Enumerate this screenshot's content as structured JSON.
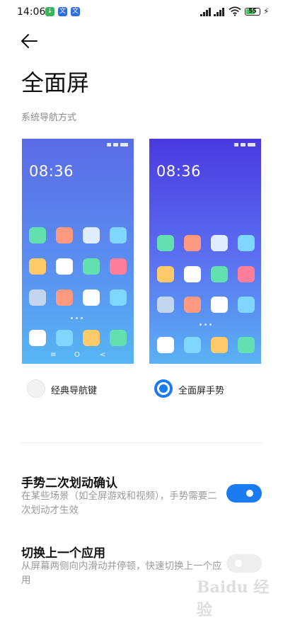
{
  "status_bar": {
    "time": "14:06",
    "battery": "55",
    "notif_icons": [
      "↓",
      "文",
      "文"
    ]
  },
  "page": {
    "title": "全面屏",
    "section_label": "系统导航方式"
  },
  "previews": {
    "classic": {
      "clock": "08:36",
      "nav_keys": [
        "≡",
        "O",
        "<"
      ]
    },
    "gesture": {
      "clock": "08:36"
    }
  },
  "options": [
    {
      "label": "经典导航键",
      "selected": false
    },
    {
      "label": "全面屏手势",
      "selected": true
    }
  ],
  "settings": [
    {
      "title": "手势二次划动确认",
      "desc": "在某些场景（如全屏游戏和视频），手势需要二次划动才生效",
      "enabled": true
    },
    {
      "title": "切换上一个应用",
      "desc": "从屏幕两侧向内滑动并停顿，快速切换上一个应用",
      "enabled": false
    }
  ],
  "watermark": "Baidu 经验",
  "colors": {
    "accent": "#1a7cf0",
    "toggle_off": "#eeeeee"
  },
  "icons": [
    "back-arrow-icon",
    "signal-icon",
    "wifi-icon",
    "battery-icon",
    "charging-icon"
  ]
}
